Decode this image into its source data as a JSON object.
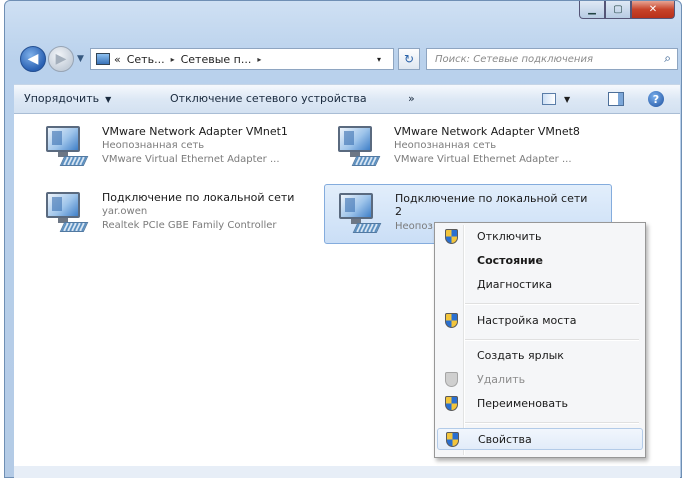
{
  "window": {
    "caption_buttons": {
      "minimize_icon": "minimize-icon",
      "maximize_icon": "maximize-icon",
      "close_icon": "close-icon"
    }
  },
  "nav": {
    "back_icon": "back-arrow-icon",
    "forward_icon": "forward-arrow-icon",
    "history_icon": "chevron-down-icon",
    "address": {
      "prefix": "«",
      "crumbs": [
        "Сеть...",
        "Сетевые п..."
      ],
      "separator": "▸",
      "dropdown": "▾"
    },
    "refresh_icon": "refresh-icon",
    "search": {
      "placeholder": "Поиск: Сетевые подключения",
      "icon": "search-icon"
    }
  },
  "toolbar": {
    "organize": "Упорядочить",
    "disconnect": "Отключение сетевого устройства",
    "more": "»",
    "view_icon": "change-view-icon",
    "preview_icon": "preview-pane-icon",
    "help_icon": "help-icon"
  },
  "connections": [
    {
      "name": "VMware Network Adapter VMnet1",
      "status": "Неопознанная сеть",
      "device": "VMware Virtual Ethernet Adapter ..."
    },
    {
      "name": "VMware Network Adapter VMnet8",
      "status": "Неопознанная сеть",
      "device": "VMware Virtual Ethernet Adapter ..."
    },
    {
      "name": "Подключение по локальной сети",
      "status": "yar.owen",
      "device": "Realtek PCIe GBE Family Controller"
    },
    {
      "name": "Подключение по локальной сети",
      "name_line2": "2",
      "status": "Неопоз",
      "selected": true
    }
  ],
  "context_menu": {
    "items": [
      {
        "label": "Отключить",
        "shield": true
      },
      {
        "label": "Состояние",
        "bold": true
      },
      {
        "label": "Диагностика"
      },
      {
        "label": "Настройка моста",
        "shield": true
      },
      {
        "label": "Создать ярлык"
      },
      {
        "label": "Удалить",
        "shield": true,
        "disabled": true
      },
      {
        "label": "Переименовать",
        "shield": true
      },
      {
        "label": "Свойства",
        "shield": true,
        "highlighted": true
      }
    ]
  },
  "colors": {
    "selection": "#cadef6",
    "menu_bg": "#f5f6f8",
    "accent": "#2a62a8"
  }
}
